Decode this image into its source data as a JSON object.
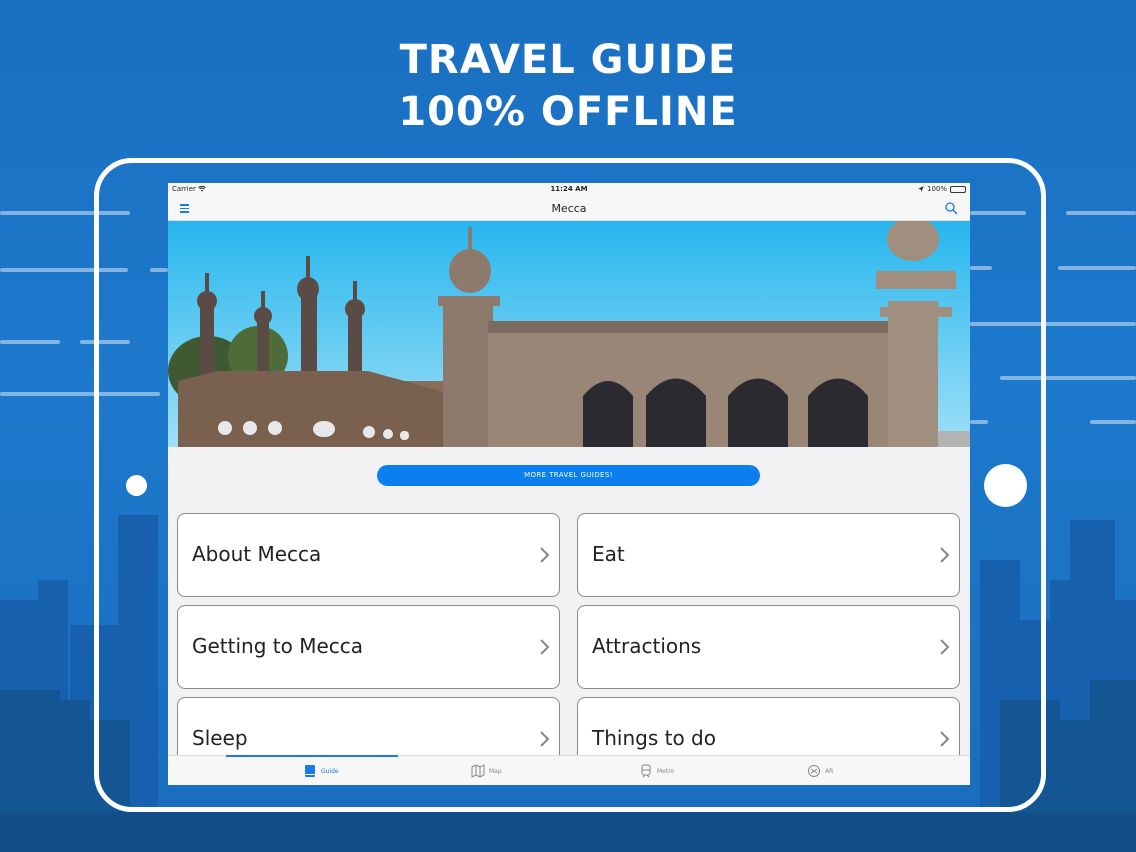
{
  "headline": {
    "line1": "TRAVEL GUIDE",
    "line2": "100% OFFLINE"
  },
  "status_bar": {
    "carrier": "Carrier",
    "time": "11:24 AM",
    "battery": "100%"
  },
  "nav": {
    "title": "Mecca",
    "menu_icon": "hamburger-icon",
    "search_icon": "search-icon"
  },
  "more_button": "MORE TRAVEL GUIDES!",
  "tiles": [
    {
      "label": "About Mecca"
    },
    {
      "label": "Eat"
    },
    {
      "label": "Getting to Mecca"
    },
    {
      "label": "Attractions"
    },
    {
      "label": "Sleep"
    },
    {
      "label": "Things to do"
    }
  ],
  "tabs": [
    {
      "label": "Guide",
      "icon": "book-icon",
      "active": true
    },
    {
      "label": "Map",
      "icon": "map-icon",
      "active": false
    },
    {
      "label": "Metro",
      "icon": "metro-icon",
      "active": false
    },
    {
      "label": "AR",
      "icon": "ar-icon",
      "active": false
    }
  ],
  "colors": {
    "background": "#1d79cc",
    "accent": "#0b7ef0",
    "battery": "#3cc24a"
  }
}
